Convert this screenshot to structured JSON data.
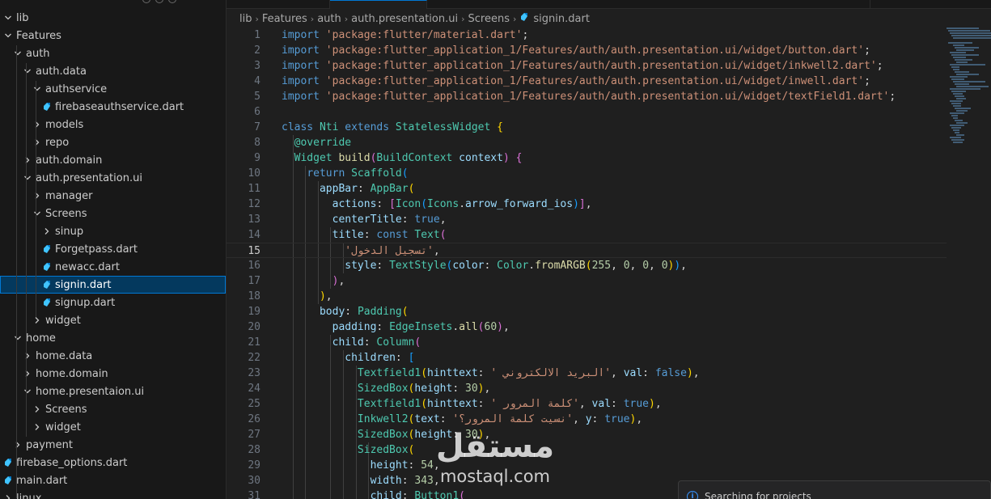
{
  "explorer": {
    "items": [
      {
        "label": "lib",
        "depth": 0,
        "kind": "folder-open"
      },
      {
        "label": "Features",
        "depth": 0,
        "kind": "folder-open"
      },
      {
        "label": "auth",
        "depth": 1,
        "kind": "folder-open"
      },
      {
        "label": "auth.data",
        "depth": 2,
        "kind": "folder-open"
      },
      {
        "label": "authservice",
        "depth": 3,
        "kind": "folder-open"
      },
      {
        "label": "firebaseauthservice.dart",
        "depth": 4,
        "kind": "dart"
      },
      {
        "label": "models",
        "depth": 3,
        "kind": "folder"
      },
      {
        "label": "repo",
        "depth": 3,
        "kind": "folder"
      },
      {
        "label": "auth.domain",
        "depth": 2,
        "kind": "folder"
      },
      {
        "label": "auth.presentation.ui",
        "depth": 2,
        "kind": "folder-open"
      },
      {
        "label": "manager",
        "depth": 3,
        "kind": "folder"
      },
      {
        "label": "Screens",
        "depth": 3,
        "kind": "folder-open"
      },
      {
        "label": "sinup",
        "depth": 4,
        "kind": "folder"
      },
      {
        "label": "Forgetpass.dart",
        "depth": 4,
        "kind": "dart"
      },
      {
        "label": "newacc.dart",
        "depth": 4,
        "kind": "dart"
      },
      {
        "label": "signin.dart",
        "depth": 4,
        "kind": "dart",
        "selected": true
      },
      {
        "label": "signup.dart",
        "depth": 4,
        "kind": "dart"
      },
      {
        "label": "widget",
        "depth": 3,
        "kind": "folder"
      },
      {
        "label": "home",
        "depth": 1,
        "kind": "folder-open"
      },
      {
        "label": "home.data",
        "depth": 2,
        "kind": "folder"
      },
      {
        "label": "home.domain",
        "depth": 2,
        "kind": "folder"
      },
      {
        "label": "home.presentaion.ui",
        "depth": 2,
        "kind": "folder-open"
      },
      {
        "label": "Screens",
        "depth": 3,
        "kind": "folder"
      },
      {
        "label": "widget",
        "depth": 3,
        "kind": "folder"
      },
      {
        "label": "payment",
        "depth": 1,
        "kind": "folder"
      },
      {
        "label": "firebase_options.dart",
        "depth": 0,
        "kind": "dart"
      },
      {
        "label": "main.dart",
        "depth": 0,
        "kind": "dart"
      },
      {
        "label": "linux",
        "depth": 0,
        "kind": "folder"
      }
    ]
  },
  "breadcrumb": [
    "lib",
    "Features",
    "auth",
    "auth.presentation.ui",
    "Screens",
    "signin.dart"
  ],
  "editor": {
    "current_line": 15,
    "lines": [
      [
        [
          "kw",
          "import "
        ],
        [
          "str",
          "'package:flutter/material.dart'"
        ],
        [
          "pun",
          ";"
        ]
      ],
      [
        [
          "kw",
          "import "
        ],
        [
          "str",
          "'package:flutter_application_1/Features/auth/auth.presentation.ui/widget/button.dart'"
        ],
        [
          "pun",
          ";"
        ]
      ],
      [
        [
          "kw",
          "import "
        ],
        [
          "str",
          "'package:flutter_application_1/Features/auth/auth.presentation.ui/widget/inkwell2.dart'"
        ],
        [
          "pun",
          ";"
        ]
      ],
      [
        [
          "kw",
          "import "
        ],
        [
          "str",
          "'package:flutter_application_1/Features/auth/auth.presentation.ui/widget/inwell.dart'"
        ],
        [
          "pun",
          ";"
        ]
      ],
      [
        [
          "kw",
          "import "
        ],
        [
          "str",
          "'package:flutter_application_1/Features/auth/auth.presentation.ui/widget/textField1.dart'"
        ],
        [
          "pun",
          ";"
        ]
      ],
      [],
      [
        [
          "kw",
          "class "
        ],
        [
          "cls",
          "Nti "
        ],
        [
          "kw",
          "extends "
        ],
        [
          "cls",
          "StatelessWidget "
        ],
        [
          "b1",
          "{"
        ]
      ],
      [
        [
          "pun",
          "  "
        ],
        [
          "ann",
          "@override"
        ]
      ],
      [
        [
          "pun",
          "  "
        ],
        [
          "cls",
          "Widget "
        ],
        [
          "fn",
          "build"
        ],
        [
          "b2",
          "("
        ],
        [
          "cls",
          "BuildContext "
        ],
        [
          "prm",
          "context"
        ],
        [
          "b2",
          ")"
        ],
        [
          "pun",
          " "
        ],
        [
          "b2",
          "{"
        ]
      ],
      [
        [
          "pun",
          "    "
        ],
        [
          "kw",
          "return "
        ],
        [
          "cls",
          "Scaffold"
        ],
        [
          "b3",
          "("
        ]
      ],
      [
        [
          "pun",
          "      "
        ],
        [
          "prm",
          "appBar"
        ],
        [
          "pun",
          ": "
        ],
        [
          "cls",
          "AppBar"
        ],
        [
          "b1",
          "("
        ]
      ],
      [
        [
          "pun",
          "        "
        ],
        [
          "prm",
          "actions"
        ],
        [
          "pun",
          ": "
        ],
        [
          "b2",
          "["
        ],
        [
          "cls",
          "Icon"
        ],
        [
          "b3",
          "("
        ],
        [
          "cls",
          "Icons"
        ],
        [
          "pun",
          "."
        ],
        [
          "prm",
          "arrow_forward_ios"
        ],
        [
          "b3",
          ")"
        ],
        [
          "b2",
          "]"
        ],
        [
          "pun",
          ","
        ]
      ],
      [
        [
          "pun",
          "        "
        ],
        [
          "prm",
          "centerTitle"
        ],
        [
          "pun",
          ": "
        ],
        [
          "kw",
          "true"
        ],
        [
          "pun",
          ","
        ]
      ],
      [
        [
          "pun",
          "        "
        ],
        [
          "prm",
          "title"
        ],
        [
          "pun",
          ": "
        ],
        [
          "kw",
          "const "
        ],
        [
          "cls",
          "Text"
        ],
        [
          "b2",
          "("
        ]
      ],
      [
        [
          "pun",
          "          "
        ],
        [
          "str",
          "'تسجيل الدخول'"
        ],
        [
          "pun",
          ","
        ]
      ],
      [
        [
          "pun",
          "          "
        ],
        [
          "prm",
          "style"
        ],
        [
          "pun",
          ": "
        ],
        [
          "cls",
          "TextStyle"
        ],
        [
          "b3",
          "("
        ],
        [
          "prm",
          "color"
        ],
        [
          "pun",
          ": "
        ],
        [
          "cls",
          "Color"
        ],
        [
          "pun",
          "."
        ],
        [
          "fn",
          "fromARGB"
        ],
        [
          "b1",
          "("
        ],
        [
          "num",
          "255"
        ],
        [
          "pun",
          ", "
        ],
        [
          "num",
          "0"
        ],
        [
          "pun",
          ", "
        ],
        [
          "num",
          "0"
        ],
        [
          "pun",
          ", "
        ],
        [
          "num",
          "0"
        ],
        [
          "b1",
          ")"
        ],
        [
          "b3",
          ")"
        ],
        [
          "pun",
          ","
        ]
      ],
      [
        [
          "pun",
          "        "
        ],
        [
          "b2",
          ")"
        ],
        [
          "pun",
          ","
        ]
      ],
      [
        [
          "pun",
          "      "
        ],
        [
          "b1",
          ")"
        ],
        [
          "pun",
          ","
        ]
      ],
      [
        [
          "pun",
          "      "
        ],
        [
          "prm",
          "body"
        ],
        [
          "pun",
          ": "
        ],
        [
          "cls",
          "Padding"
        ],
        [
          "b1",
          "("
        ]
      ],
      [
        [
          "pun",
          "        "
        ],
        [
          "prm",
          "padding"
        ],
        [
          "pun",
          ": "
        ],
        [
          "cls",
          "EdgeInsets"
        ],
        [
          "pun",
          "."
        ],
        [
          "fn",
          "all"
        ],
        [
          "b2",
          "("
        ],
        [
          "num",
          "60"
        ],
        [
          "b2",
          ")"
        ],
        [
          "pun",
          ","
        ]
      ],
      [
        [
          "pun",
          "        "
        ],
        [
          "prm",
          "child"
        ],
        [
          "pun",
          ": "
        ],
        [
          "cls",
          "Column"
        ],
        [
          "b2",
          "("
        ]
      ],
      [
        [
          "pun",
          "          "
        ],
        [
          "prm",
          "children"
        ],
        [
          "pun",
          ": "
        ],
        [
          "b3",
          "["
        ]
      ],
      [
        [
          "pun",
          "            "
        ],
        [
          "cls",
          "Textfield1"
        ],
        [
          "b1",
          "("
        ],
        [
          "prm",
          "hinttext"
        ],
        [
          "pun",
          ": "
        ],
        [
          "str",
          "' البريد الالكتروني'"
        ],
        [
          "pun",
          ", "
        ],
        [
          "prm",
          "val"
        ],
        [
          "pun",
          ": "
        ],
        [
          "kw",
          "false"
        ],
        [
          "b1",
          ")"
        ],
        [
          "pun",
          ","
        ]
      ],
      [
        [
          "pun",
          "            "
        ],
        [
          "cls",
          "SizedBox"
        ],
        [
          "b1",
          "("
        ],
        [
          "prm",
          "height"
        ],
        [
          "pun",
          ": "
        ],
        [
          "num",
          "30"
        ],
        [
          "b1",
          ")"
        ],
        [
          "pun",
          ","
        ]
      ],
      [
        [
          "pun",
          "            "
        ],
        [
          "cls",
          "Textfield1"
        ],
        [
          "b1",
          "("
        ],
        [
          "prm",
          "hinttext"
        ],
        [
          "pun",
          ": "
        ],
        [
          "str",
          "' كلمة المرور'"
        ],
        [
          "pun",
          ", "
        ],
        [
          "prm",
          "val"
        ],
        [
          "pun",
          ": "
        ],
        [
          "kw",
          "true"
        ],
        [
          "b1",
          ")"
        ],
        [
          "pun",
          ","
        ]
      ],
      [
        [
          "pun",
          "            "
        ],
        [
          "cls",
          "Inkwell2"
        ],
        [
          "b1",
          "("
        ],
        [
          "prm",
          "text"
        ],
        [
          "pun",
          ": "
        ],
        [
          "str",
          "'نسيت كلمة المرور؟'"
        ],
        [
          "pun",
          ", "
        ],
        [
          "prm",
          "y"
        ],
        [
          "pun",
          ": "
        ],
        [
          "kw",
          "true"
        ],
        [
          "b1",
          ")"
        ],
        [
          "pun",
          ","
        ]
      ],
      [
        [
          "pun",
          "            "
        ],
        [
          "cls",
          "SizedBox"
        ],
        [
          "b1",
          "("
        ],
        [
          "prm",
          "height"
        ],
        [
          "pun",
          ": "
        ],
        [
          "num",
          "30"
        ],
        [
          "b1",
          ")"
        ],
        [
          "pun",
          ","
        ]
      ],
      [
        [
          "pun",
          "            "
        ],
        [
          "cls",
          "SizedBox"
        ],
        [
          "b1",
          "("
        ]
      ],
      [
        [
          "pun",
          "              "
        ],
        [
          "prm",
          "height"
        ],
        [
          "pun",
          ": "
        ],
        [
          "num",
          "54"
        ],
        [
          "pun",
          ","
        ]
      ],
      [
        [
          "pun",
          "              "
        ],
        [
          "prm",
          "width"
        ],
        [
          "pun",
          ": "
        ],
        [
          "num",
          "343"
        ],
        [
          "pun",
          ","
        ]
      ],
      [
        [
          "pun",
          "              "
        ],
        [
          "prm",
          "child"
        ],
        [
          "pun",
          ": "
        ],
        [
          "cls",
          "Button1"
        ],
        [
          "b2",
          "("
        ]
      ]
    ]
  },
  "watermark": {
    "arabic": "مستقل",
    "latin": "mostaql.com"
  },
  "notification": {
    "text": "Searching for projects",
    "icon": "info-icon"
  }
}
